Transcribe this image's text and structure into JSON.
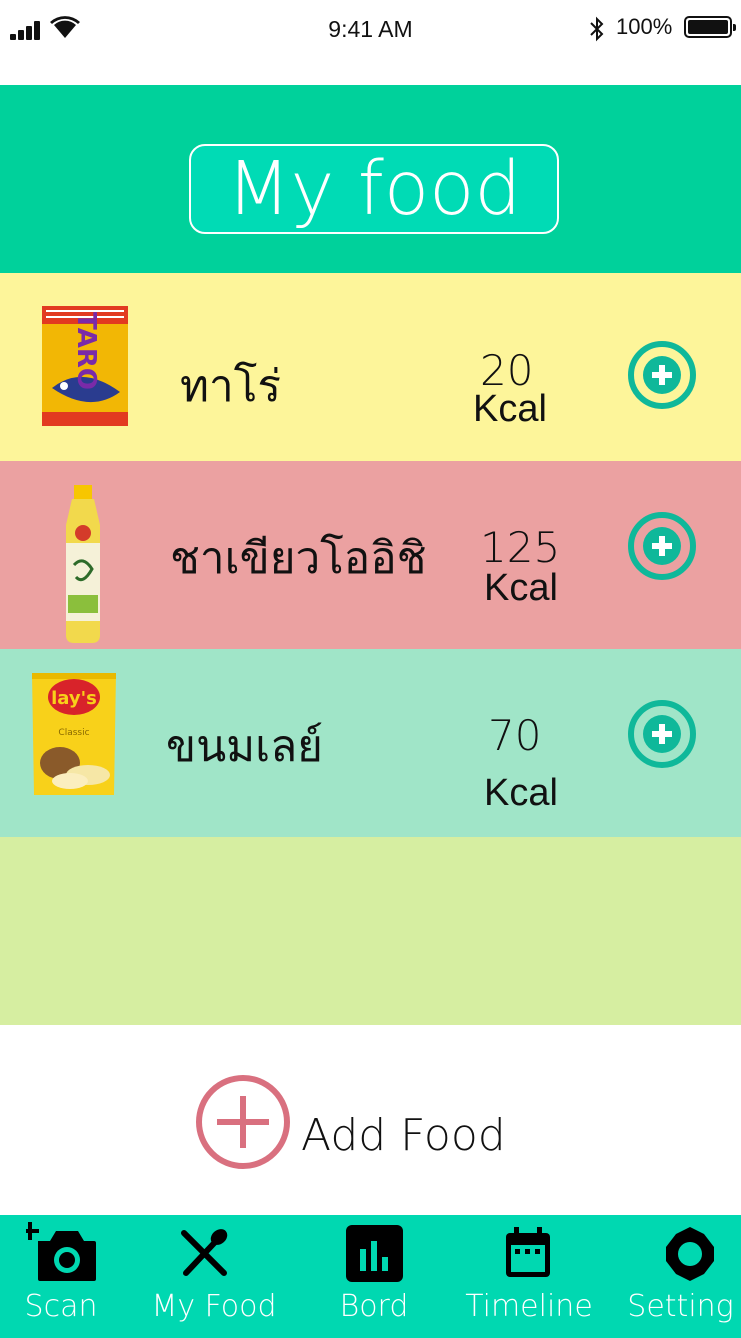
{
  "status_bar": {
    "time": "9:41 AM",
    "battery_percent": "100%",
    "battery_level": 1.0,
    "icons": [
      "signal-icon",
      "wifi-icon",
      "bluetooth-icon",
      "battery-icon"
    ]
  },
  "header": {
    "title": "My food"
  },
  "foods": [
    {
      "name": "ทาโร่",
      "kcal_value": "20",
      "kcal_unit": "Kcal",
      "image": "taro-snack-image",
      "row_color": "#fdf59a"
    },
    {
      "name": "ชาเขียวโออิชิ",
      "kcal_value": "125",
      "kcal_unit": "Kcal",
      "image": "oishi-green-tea-image",
      "row_color": "#eba1a1"
    },
    {
      "name": "ขนมเลย์",
      "kcal_value": "70",
      "kcal_unit": "Kcal",
      "image": "lays-chips-image",
      "row_color": "#a0e5c8"
    }
  ],
  "add_food": {
    "label": "Add Food",
    "icon": "plus-circle-icon"
  },
  "tabbar": {
    "items": [
      {
        "label": "Scan",
        "icon": "camera-plus-icon"
      },
      {
        "label": "My Food",
        "icon": "fork-spoon-icon"
      },
      {
        "label": "Bord",
        "icon": "bar-chart-icon"
      },
      {
        "label": "Timeline",
        "icon": "calendar-icon"
      },
      {
        "label": "Setting",
        "icon": "gear-icon"
      }
    ]
  },
  "colors": {
    "header": "#00d19b",
    "accent_teal": "#0fb89a",
    "add_food_pink": "#d9707f",
    "tabbar": "#00d8b1",
    "empty_row": "#d6eea1"
  }
}
